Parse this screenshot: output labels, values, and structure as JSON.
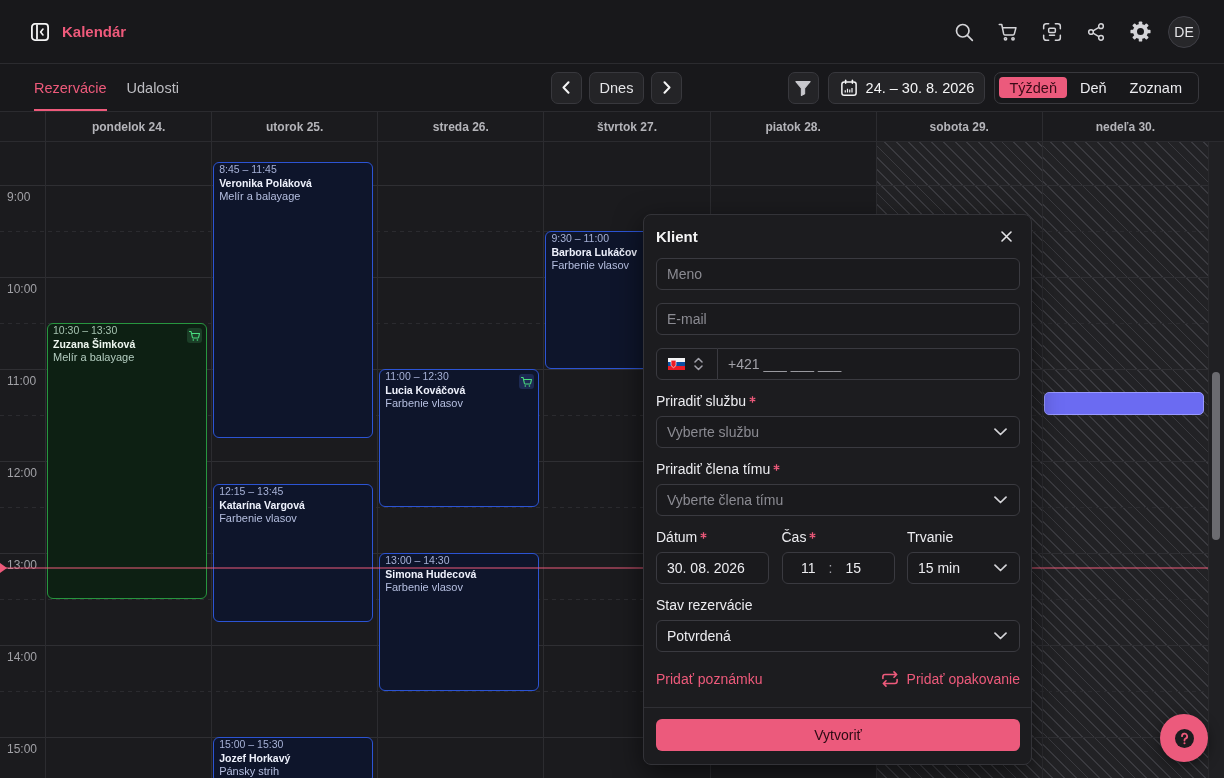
{
  "header": {
    "title": "Kalendár",
    "avatar": "DE"
  },
  "tabs": [
    {
      "label": "Rezervácie",
      "selected": true
    },
    {
      "label": "Udalosti",
      "selected": false
    }
  ],
  "navigation": {
    "today": "Dnes",
    "date_range": "24. – 30. 8. 2026"
  },
  "views": [
    {
      "label": "Týždeň",
      "selected": true
    },
    {
      "label": "Deň",
      "selected": false
    },
    {
      "label": "Zoznam",
      "selected": false
    }
  ],
  "hours": [
    "9:00",
    "10:00",
    "11:00",
    "12:00",
    "13:00",
    "14:00",
    "15:00"
  ],
  "days": [
    {
      "label": "pondelok 24.",
      "closed": false,
      "draft": false,
      "events": [
        {
          "time": "10:30 – 13:30",
          "client": "Zuzana Šimková",
          "service": "Melír a balayage",
          "color": "#27963f",
          "cart": true
        }
      ]
    },
    {
      "label": "utorok 25.",
      "closed": false,
      "draft": false,
      "events": [
        {
          "time": "8:45 – 11:45",
          "client": "Veronika Poláková",
          "service": "Melír a balayage",
          "color": "#2c54d4",
          "cart": false
        },
        {
          "time": "12:15 – 13:45",
          "client": "Katarína Vargová",
          "service": "Farbenie vlasov",
          "color": "#2c54d4",
          "cart": false
        },
        {
          "time": "15:00 – 15:30",
          "client": "Jozef Horkavý",
          "service": "Pánsky strih",
          "color": "#2c54d4",
          "cart": false
        }
      ]
    },
    {
      "label": "streda 26.",
      "closed": false,
      "draft": false,
      "events": [
        {
          "time": "11:00 – 12:30",
          "client": "Lucia Kováčová",
          "service": "Farbenie vlasov",
          "color": "#2c54d4",
          "cart": true
        },
        {
          "time": "13:00 – 14:30",
          "client": "Simona Hudecová",
          "service": "Farbenie vlasov",
          "color": "#2c54d4",
          "cart": false
        }
      ]
    },
    {
      "label": "štvrtok 27.",
      "closed": false,
      "draft": false,
      "events": [
        {
          "time": "9:30 – 11:00",
          "client": "Barbora Lukáčov",
          "service": "Farbenie vlasov",
          "color": "#2c54d4",
          "cart": false
        }
      ]
    },
    {
      "label": "piatok 28.",
      "closed": false,
      "draft": false
    },
    {
      "label": "sobota 29.",
      "closed": true,
      "draft": false
    },
    {
      "label": "nedeľa 30.",
      "closed": true,
      "draft": true
    }
  ],
  "booking_form": {
    "title": "Klient",
    "name": {
      "placeholder": "Meno"
    },
    "email": {
      "placeholder": "E-mail"
    },
    "phone": {
      "placeholder": "+421 ___ ___ ___"
    },
    "service": {
      "label": "Priradiť službu",
      "required": true,
      "placeholder": "Vyberte službu"
    },
    "team_member": {
      "label": "Priradiť člena tímu",
      "required": true,
      "placeholder": "Vyberte člena tímu"
    },
    "date": {
      "label": "Dátum",
      "required": true,
      "value": "30. 08. 2026"
    },
    "time": {
      "label": "Čas",
      "required": true,
      "hours": "11",
      "separator": ":",
      "minutes": "15"
    },
    "duration": {
      "label": "Trvanie",
      "required": false,
      "value": "15 min"
    },
    "status": {
      "label": "Stav rezervácie",
      "required": false,
      "value": "Potvrdená"
    },
    "add_note": "Pridať poznámku",
    "add_recurrence": "Pridať opakovanie",
    "submit": "Vytvoriť"
  }
}
